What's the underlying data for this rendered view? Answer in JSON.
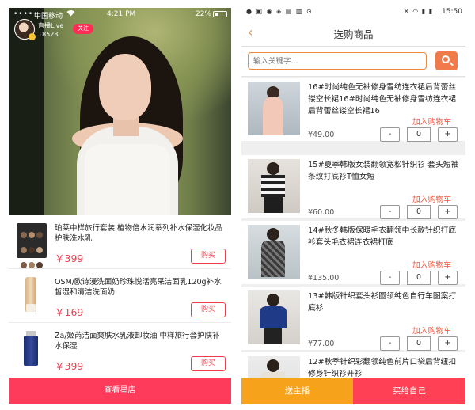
{
  "left": {
    "status": {
      "signal": "•••••",
      "carrier": "中国移动",
      "wifi_icon": "wifi-icon",
      "time": "4:21 PM",
      "battery": "22%"
    },
    "host": {
      "name": "直播Live",
      "id": "18523",
      "follow_label": "关注"
    },
    "products": [
      {
        "name": "珀莱中样旅行套装 植物倍水润系列补水保湿化妆品 护肤洗水乳",
        "price": "￥399",
        "buy_label": "购买",
        "icon": "eyeshadow-palette-icon"
      },
      {
        "name": "OSM/欧诗漫洗面奶珍珠悦活亮采洁面乳120g补水皙湿和清洁洗面奶",
        "price": "￥169",
        "buy_label": "购买",
        "icon": "cleanser-tube-icon"
      },
      {
        "name": "Za/姬芮洁面爽肤水乳液卸妆油 中样旅行套护肤补水保湿",
        "price": "￥399",
        "buy_label": "购买",
        "icon": "serum-bottle-icon"
      }
    ],
    "shop_button": "查看星店",
    "colors": {
      "accent": "#ff3b5c",
      "price": "#f23c4e"
    }
  },
  "right": {
    "status": {
      "time": "15:50"
    },
    "title": "选购商品",
    "search": {
      "placeholder": "输入关键字..."
    },
    "goods": [
      {
        "name": "16#时尚纯色无袖修身雪纺连衣裙后背蕾丝镂空长裙16#时尚纯色无袖修身雪纺连衣裙后背蕾丝镂空长裙16",
        "add_label": "加入购物车",
        "price": "¥49.00",
        "qty": "0",
        "minus": "-",
        "plus": "+"
      },
      {
        "name": "15#夏季韩版女装翻领宽松针织衫 套头短袖条纹打底衫T恤女短",
        "add_label": "加入购物车",
        "price": "¥60.00",
        "qty": "0",
        "minus": "-",
        "plus": "+"
      },
      {
        "name": "14#秋冬韩版保暖毛衣翻领中长款针织打底衫套头毛衣裙连衣裙打底",
        "add_label": "加入购物车",
        "price": "¥135.00",
        "qty": "0",
        "minus": "-",
        "plus": "+"
      },
      {
        "name": "13#韩版针织套头衫圆领纯色自行车图案打底衫",
        "add_label": "加入购物车",
        "price": "¥77.00",
        "qty": "0",
        "minus": "-",
        "plus": "+"
      },
      {
        "name": "12#秋季针织彩翻领纯色前片口袋后背纽扣修身针织衫开衫",
        "add_label": "",
        "price": "",
        "qty": "",
        "minus": "",
        "plus": ""
      }
    ],
    "bottom": {
      "send_host": "送主播",
      "buy_self": "买给自己"
    },
    "colors": {
      "orange": "#f7a21b",
      "red": "#ff4055",
      "cart_text": "#f0543a"
    }
  }
}
